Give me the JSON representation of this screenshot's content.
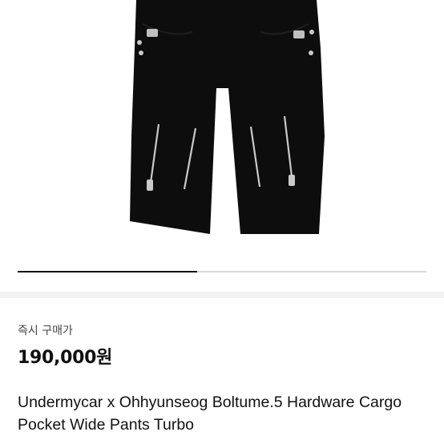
{
  "listing": {
    "image_alt": "black cargo wide pants with zipper hardware",
    "image_progress": 0.44,
    "purchase_type": "즉시 구매가",
    "price": "190,000원",
    "title": "Undermycar x Ohhyunseog Boltume.5 Hardware Cargo Pocket Wide Pants Turbo"
  },
  "colors": {
    "garment": "#0d0d0d",
    "hardware": "#c9c9c9",
    "progress_fill": "#111111",
    "progress_track": "#d9d9d9",
    "section_band": "#f2f2f2"
  }
}
